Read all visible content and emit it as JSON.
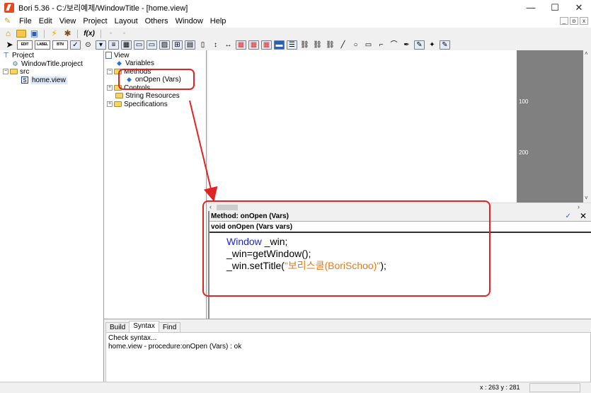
{
  "window": {
    "title": "Bori 5.36 - C:/보리예제/WindowTitle - [home.view]",
    "minimize": "—",
    "maximize": "☐",
    "close": "✕"
  },
  "menu": {
    "items": [
      "File",
      "Edit",
      "View",
      "Project",
      "Layout",
      "Others",
      "Window",
      "Help"
    ],
    "mdi_min": "_",
    "mdi_restore": "ɒ",
    "mdi_close": "x"
  },
  "toolbar2": {
    "edit": "EDIT",
    "label": "LABEL",
    "btn": "BTN"
  },
  "project_tree": {
    "root": "Project",
    "project_file": "WindowTitle.project",
    "src": "src",
    "view_file": "home.view"
  },
  "view_tree": {
    "root": "View",
    "variables": "Variables",
    "methods": "Methods",
    "method_item": "onOpen (Vars)",
    "controls": "Controls",
    "string_resources": "String Resources",
    "specifications": "Specifications"
  },
  "canvas": {
    "ruler_100": "100",
    "ruler_200": "200"
  },
  "method_panel": {
    "header": "Method: onOpen (Vars)",
    "signature": "void onOpen (Vars vars)",
    "code": {
      "line1_type": "Window",
      "line1_rest": " _win;",
      "line2": "_win=getWindow();",
      "line3_pre": "_win.setTitle(",
      "line3_str": "\"보리스쿨(BoriSchoo)\"",
      "line3_post": ");"
    }
  },
  "bottom": {
    "tabs": [
      "Build",
      "Syntax",
      "Find"
    ],
    "output_line1": "Check syntax...",
    "output_line2": "home.view - procedure:onOpen (Vars) : ok"
  },
  "status": {
    "coords": "x : 263  y : 281"
  },
  "colors": {
    "highlight_red": "#e02424",
    "keyword_blue": "#1c25d8",
    "string_orange": "#e07b1a"
  }
}
